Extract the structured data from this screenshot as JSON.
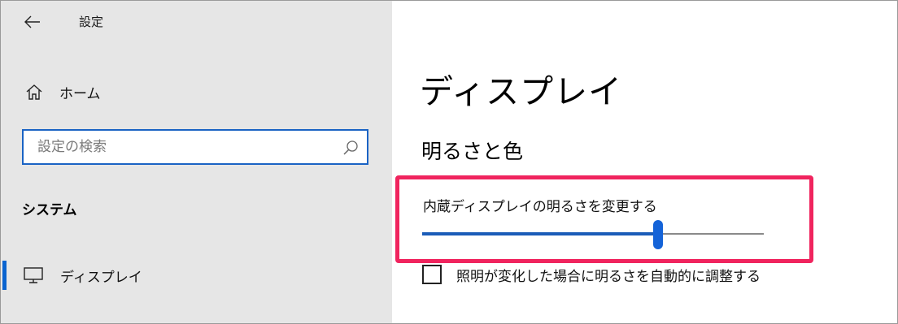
{
  "window": {
    "title": "設定"
  },
  "sidebar": {
    "home_label": "ホーム",
    "search_placeholder": "設定の検索",
    "section_title": "システム",
    "items": [
      {
        "label": "ディスプレイ",
        "icon": "monitor-icon",
        "selected": true
      }
    ]
  },
  "main": {
    "heading": "ディスプレイ",
    "section": "明るさと色",
    "brightness": {
      "label": "内蔵ディスプレイの明るさを変更する",
      "value_percent": 69
    },
    "auto_brightness": {
      "label": "照明が変化した場合に明るさを自動的に調整する",
      "checked": false
    }
  },
  "colors": {
    "accent": "#0a64d0",
    "highlight": "#f0245e",
    "sidebar_bg": "#e6e6e6"
  }
}
